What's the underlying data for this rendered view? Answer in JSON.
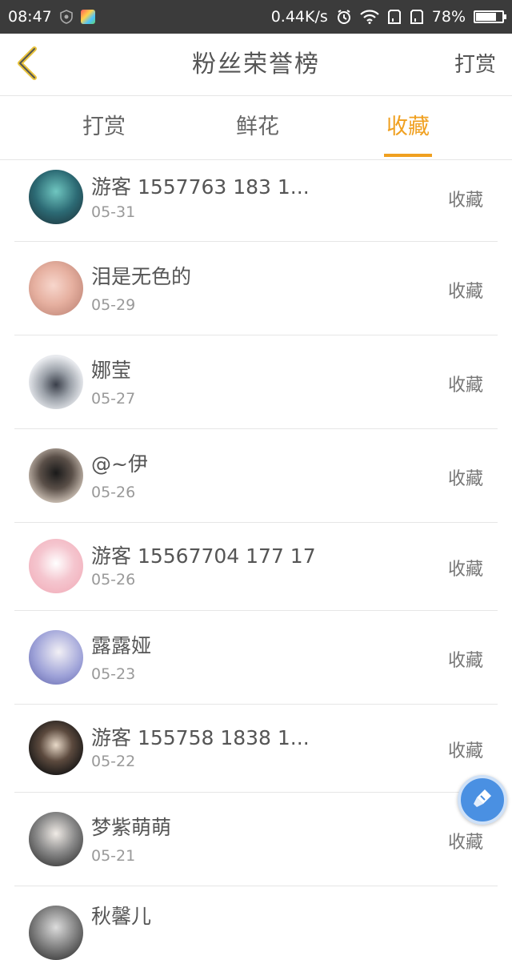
{
  "status_bar": {
    "time": "08:47",
    "speed": "0.44K/s",
    "battery": "78%",
    "battery_level": 0.78
  },
  "header": {
    "title": "粉丝荣誉榜",
    "right_link": "打赏"
  },
  "tabs": [
    {
      "label": "打赏",
      "active": false
    },
    {
      "label": "鲜花",
      "active": false
    },
    {
      "label": "收藏",
      "active": true
    }
  ],
  "accent_color": "#f0a020",
  "rows": [
    {
      "name": "游客 1557763 183 1...",
      "date": "05-31",
      "action": "收藏"
    },
    {
      "name": "泪是无色的",
      "date": "05-29",
      "action": "收藏"
    },
    {
      "name": "娜莹",
      "date": "05-27",
      "action": "收藏"
    },
    {
      "name": "@~伊",
      "date": "05-26",
      "action": "收藏"
    },
    {
      "name": "游客 15567704 177 17",
      "date": "05-26",
      "action": "收藏"
    },
    {
      "name": "露露娅",
      "date": "05-23",
      "action": "收藏"
    },
    {
      "name": "游客 155758 1838 1...",
      "date": "05-22",
      "action": "收藏"
    },
    {
      "name": "梦紫萌萌",
      "date": "05-21",
      "action": "收藏"
    },
    {
      "name": "秋馨儿",
      "date": "",
      "action": ""
    }
  ],
  "icons": {
    "back": "chevron-left-icon",
    "fab": "brush-icon"
  }
}
